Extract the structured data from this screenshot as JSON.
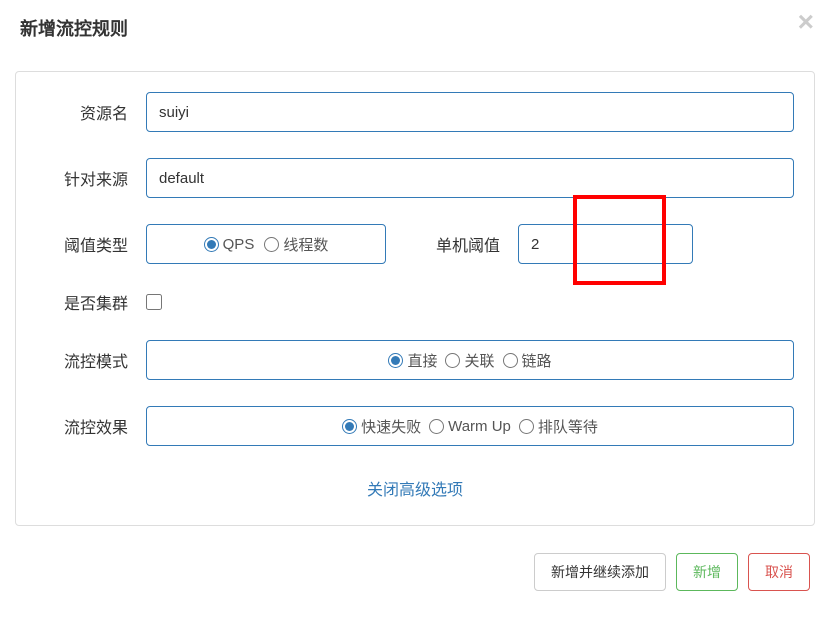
{
  "modal": {
    "title": "新增流控规则",
    "close_symbol": "×"
  },
  "form": {
    "resource": {
      "label": "资源名",
      "value": "suiyi"
    },
    "source": {
      "label": "针对来源",
      "value": "default"
    },
    "threshold_type": {
      "label": "阈值类型",
      "options": {
        "qps": "QPS",
        "thread": "线程数"
      }
    },
    "threshold_value": {
      "label": "单机阈值",
      "value": "2"
    },
    "cluster": {
      "label": "是否集群"
    },
    "flow_mode": {
      "label": "流控模式",
      "options": {
        "direct": "直接",
        "relate": "关联",
        "chain": "链路"
      }
    },
    "flow_effect": {
      "label": "流控效果",
      "options": {
        "fail_fast": "快速失败",
        "warm_up": "Warm Up",
        "queue": "排队等待"
      }
    },
    "collapse_link": "关闭高级选项"
  },
  "footer": {
    "add_continue": "新增并继续添加",
    "add": "新增",
    "cancel": "取消"
  }
}
